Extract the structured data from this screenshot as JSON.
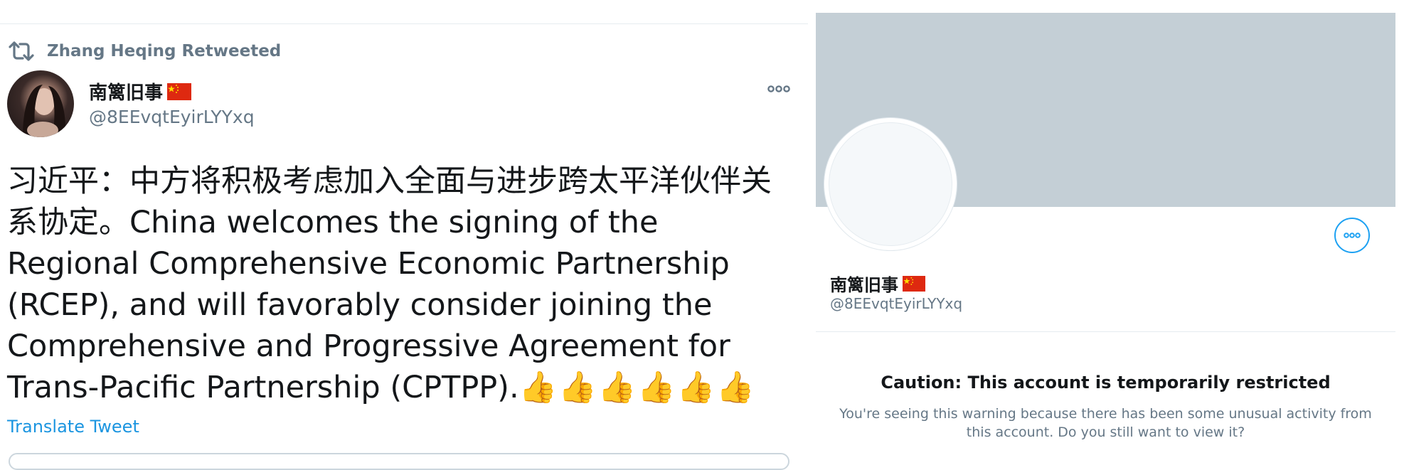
{
  "tweet": {
    "retweet_label": "Zhang Heqing Retweeted",
    "author_name": "南篱旧事",
    "author_handle": "@8EEvqtEyirLYYxq",
    "text": "习近平：中方将积极考虑加入全面与进步跨太平洋伙伴关系协定。China welcomes the signing of the Regional Comprehensive Economic Partnership (RCEP), and will favorably consider joining the Comprehensive and Progressive Agreement for Trans-Pacific Partnership (CPTPP).",
    "emoji": "👍👍👍👍👍👍",
    "translate_label": "Translate Tweet"
  },
  "profile": {
    "name": "南篱旧事",
    "handle": "@8EEvqtEyirLYYxq",
    "caution_title": "Caution: This account is temporarily restricted",
    "caution_body": "You're seeing this warning because there has been some unusual activity from this account. Do you still want to view it?"
  },
  "colors": {
    "accent": "#1da1f2",
    "link": "#1b95e0",
    "muted": "#657786",
    "banner": "#c4cfd6",
    "flag_red": "#de2910",
    "flag_star": "#ffde00"
  },
  "icons": [
    "retweet-icon",
    "more-icon",
    "china-flag-icon"
  ]
}
